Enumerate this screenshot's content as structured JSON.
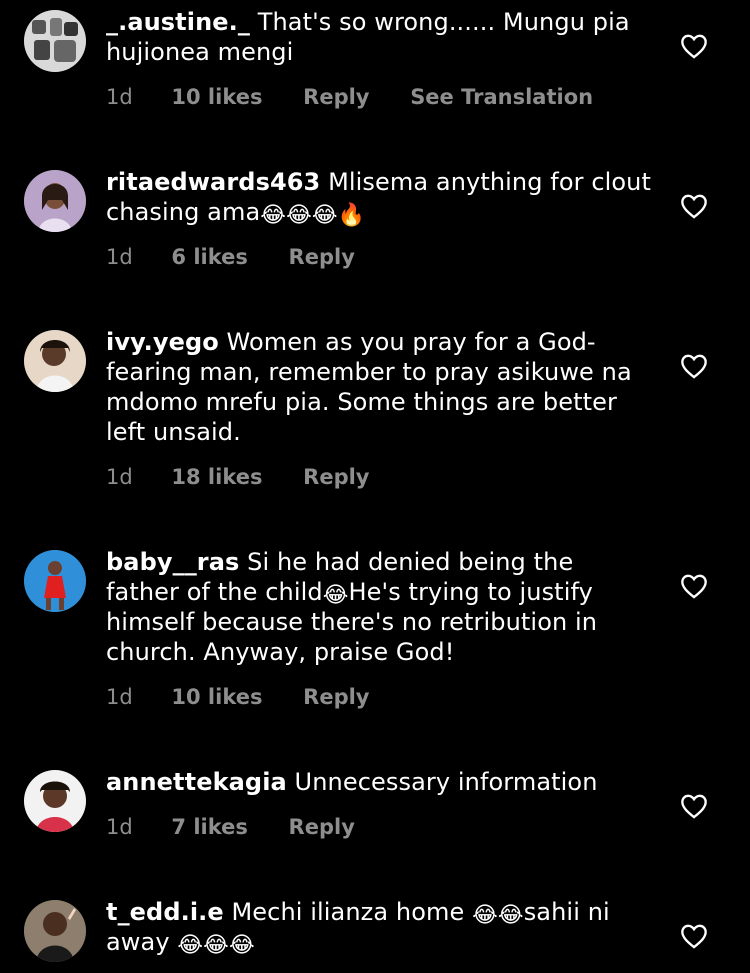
{
  "comments": [
    {
      "username": "_.austine._",
      "text": " That's so wrong...... Mungu pia hujionea mengi",
      "time": "1d",
      "likes": "10 likes",
      "reply": "Reply",
      "translation": "See Translation"
    },
    {
      "username": "ritaedwards463",
      "text": " Mlisema anything for clout chasing ama",
      "emojis": "😂😂😂🔥",
      "time": "1d",
      "likes": "6 likes",
      "reply": "Reply"
    },
    {
      "username": "ivy.yego",
      "text": " Women as you pray for a God-fearing man, remember to pray asikuwe na mdomo mrefu pia. Some things are better left unsaid.",
      "time": "1d",
      "likes": "18 likes",
      "reply": "Reply"
    },
    {
      "username": "baby__ras",
      "text_a": " Si he had denied being the father of the child",
      "emoji_mid": "😂",
      "text_b": "He's trying to justify himself because there's no retribution in church. Anyway, praise God!",
      "time": "1d",
      "likes": "10 likes",
      "reply": "Reply"
    },
    {
      "username": "annettekagia",
      "text": " Unnecessary information",
      "time": "1d",
      "likes": "7 likes",
      "reply": "Reply"
    },
    {
      "username": "t_edd.i.e",
      "text_a": " Mechi ilianza home ",
      "emoji_a": "😂😂",
      "text_b": "sahii ni away ",
      "emoji_b": "😂😂😂"
    }
  ],
  "icons": {
    "like": "heart-outline-icon"
  },
  "colors": {
    "background": "#000000",
    "text": "#ffffff",
    "meta": "#8e8e8e"
  }
}
